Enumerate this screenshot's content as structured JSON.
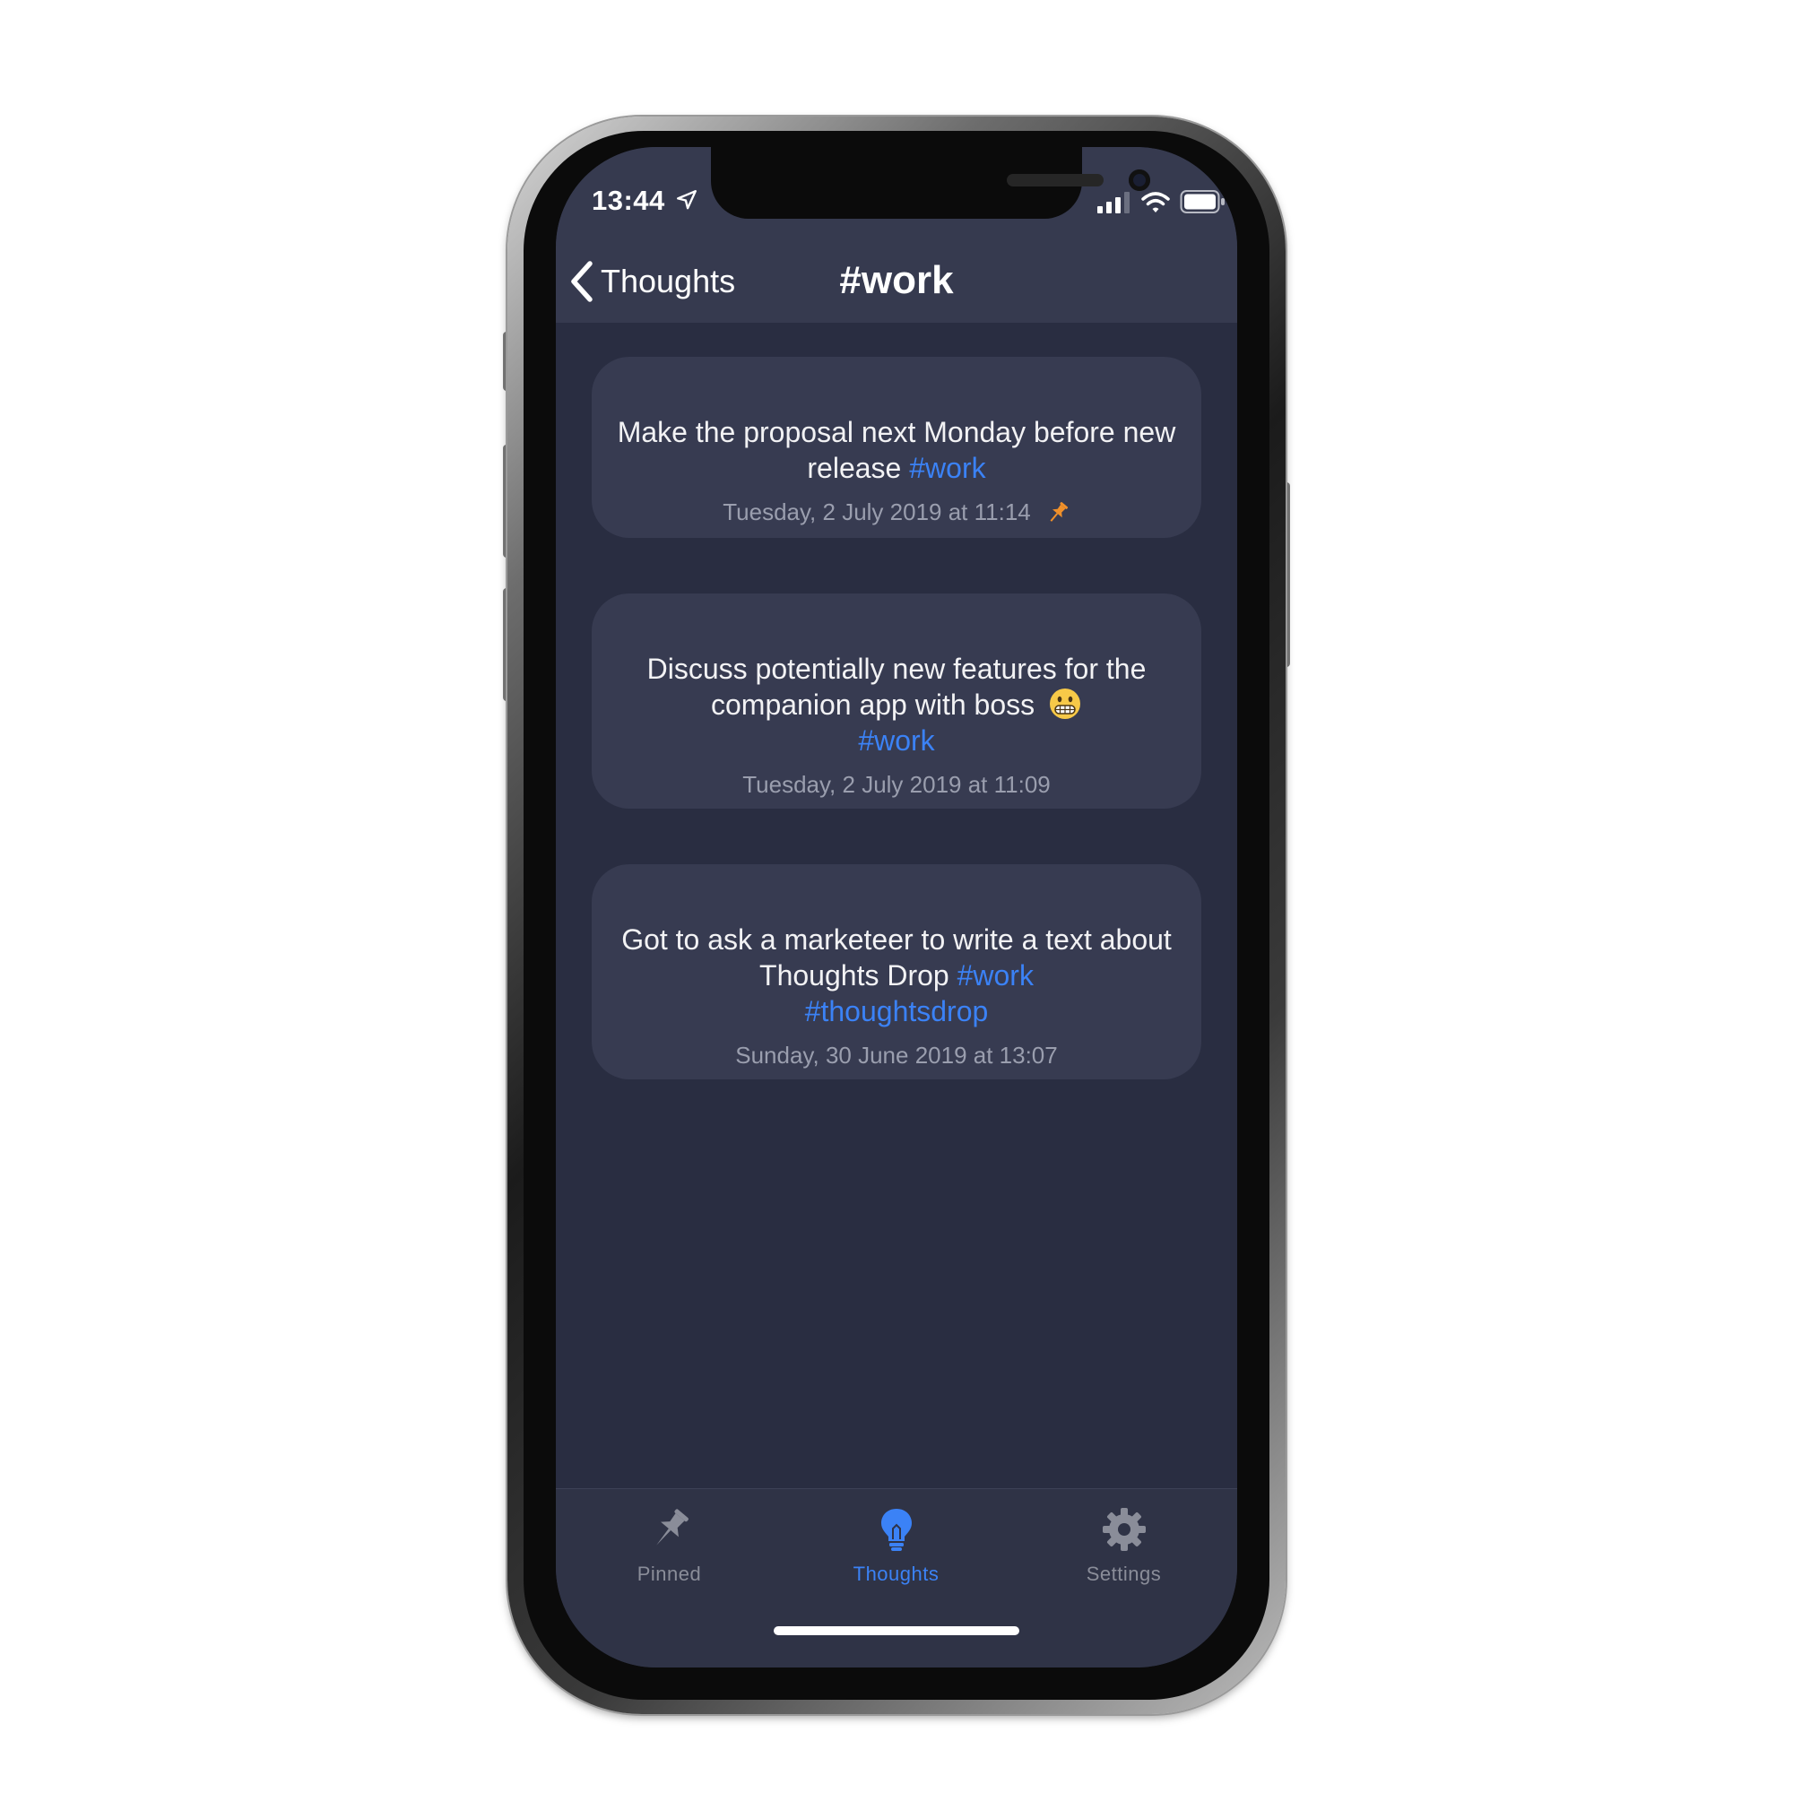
{
  "status_bar": {
    "time": "13:44"
  },
  "nav": {
    "back_label": "Thoughts",
    "title": "#work"
  },
  "thoughts": [
    {
      "text": "Make the proposal next Monday before new release",
      "tags": [
        "#work"
      ],
      "timestamp": "Tuesday, 2 July 2019 at 11:14",
      "pinned": true
    },
    {
      "text": "Discuss potentially new features for the companion app with boss",
      "emoji": "grimacing-face",
      "tags": [
        "#work"
      ],
      "timestamp": "Tuesday, 2 July 2019 at 11:09",
      "pinned": false
    },
    {
      "text": "Got to ask a marketeer to write a text about Thoughts Drop",
      "tags": [
        "#work",
        "#thoughtsdrop"
      ],
      "timestamp": "Sunday, 30 June 2019 at 13:07",
      "pinned": false
    }
  ],
  "tab_bar": {
    "pinned": {
      "label": "Pinned",
      "icon": "pin-icon"
    },
    "thoughts": {
      "label": "Thoughts",
      "icon": "lightbulb-icon",
      "active": true
    },
    "settings": {
      "label": "Settings",
      "icon": "gear-icon"
    }
  },
  "colors": {
    "background": "#292d41",
    "card": "#373b51",
    "header": "#363a4f",
    "accent": "#3b82f6",
    "pin": "#f0902a"
  }
}
